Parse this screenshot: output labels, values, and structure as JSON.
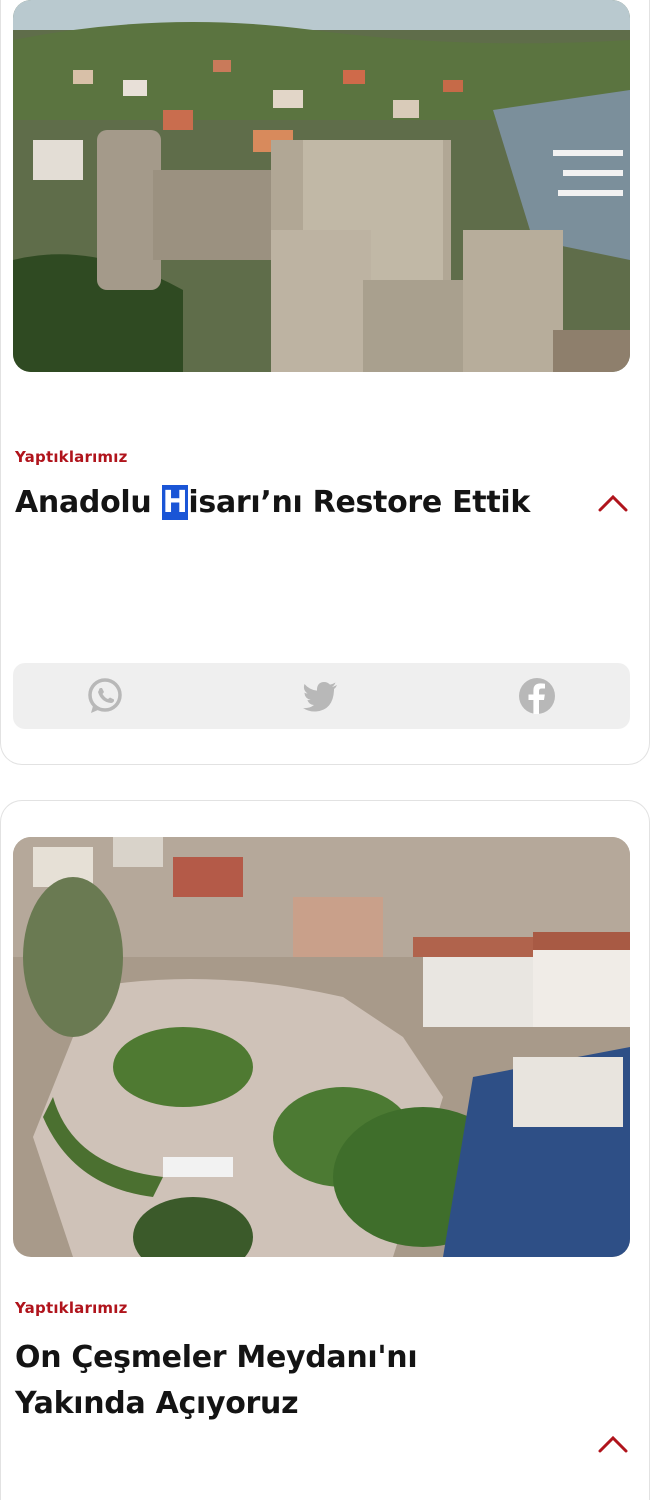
{
  "articles": [
    {
      "category": "Yaptıklarımız",
      "title_before": "Anadolu ",
      "title_selected": "H",
      "title_after": "isarı’nı Restore Ettik",
      "image": "anadolu-hisari-castle-photo",
      "share": {
        "icons": [
          "whatsapp-icon",
          "twitter-icon",
          "facebook-icon"
        ]
      }
    },
    {
      "category": "Yaptıklarımız",
      "title_line1": "On Çeşmeler Meydanı'nı",
      "title_line2": "Yakında Açıyoruz",
      "image": "on-cesmeler-square-rendering"
    }
  ],
  "colors": {
    "category": "#b0141c",
    "chevron": "#b0141c",
    "selection": "#1a55d6",
    "share_bar": "#efefef",
    "share_icon": "#b8b8b8"
  }
}
